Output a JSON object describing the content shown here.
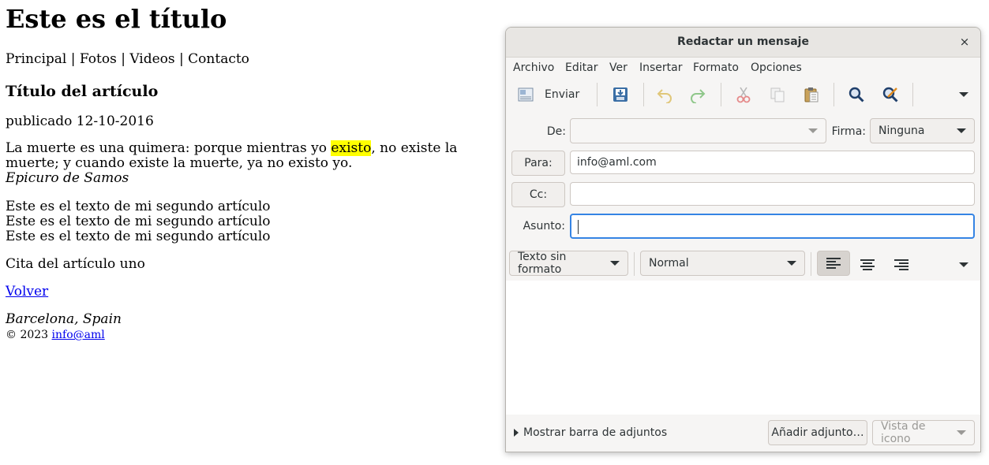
{
  "webpage": {
    "title": "Este es el título",
    "nav": "Principal | Fotos | Videos | Contacto",
    "article_title": "Título del artículo",
    "published": "publicado 12-10-2016",
    "quote_before": "La muerte es una quimera: porque mientras yo ",
    "quote_highlight": "existo",
    "quote_after": ", no existe la muerte; y cuando existe la muerte, ya no existo yo.",
    "quote_author": "Epicuro de Samos",
    "article_lines": [
      "Este es el texto de mi segundo artículo",
      "Este es el texto de mi segundo artículo",
      "Este es el texto de mi segundo artículo"
    ],
    "cite": "Cita del artículo uno",
    "back_link": "Volver",
    "city": "Barcelona, Spain",
    "copyright": "© 2023",
    "email_link": "info@aml"
  },
  "dialog": {
    "title": "Redactar un mensaje",
    "close_glyph": "×",
    "menu": [
      "Archivo",
      "Editar",
      "Ver",
      "Insertar",
      "Formato",
      "Opciones"
    ],
    "toolbar": {
      "send_label": "Enviar"
    },
    "from_label": "De:",
    "from_value": "",
    "signature_label": "Firma:",
    "signature_value": "Ninguna",
    "to_button": "Para:",
    "to_value": "info@aml.com",
    "cc_button": "Cc:",
    "cc_value": "",
    "subject_label": "Asunto:",
    "subject_value": "",
    "format_mode": "Texto sin formato",
    "paragraph_style": "Normal",
    "body_text": "",
    "attachments_toggle": "Mostrar barra de adjuntos",
    "add_attachment": "Añadir adjunto…",
    "view_mode": "Vista de icono",
    "colors": {
      "focus": "#3584e4",
      "highlight": "#ffff00",
      "link": "#0000ee"
    }
  }
}
